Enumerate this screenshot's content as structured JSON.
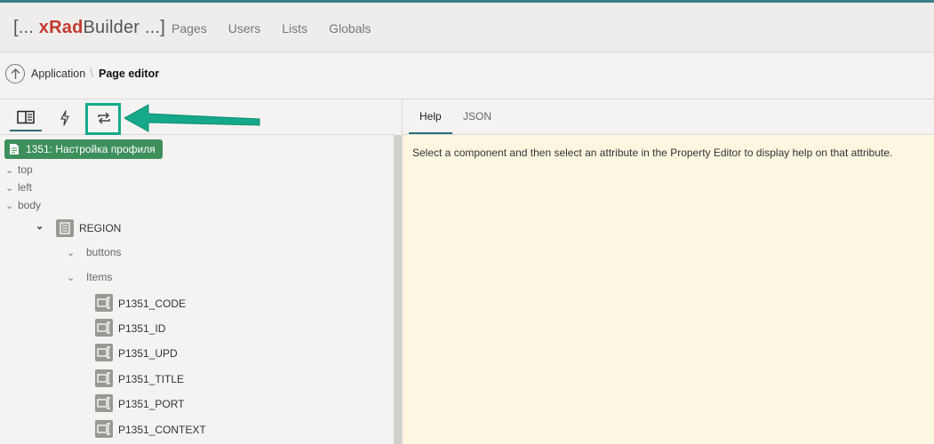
{
  "header": {
    "logo": {
      "bracket_open": "[...",
      "x": "x",
      "rad": "Rad",
      "builder": "Builder",
      "bracket_close": "...]"
    },
    "nav": [
      "Pages",
      "Users",
      "Lists",
      "Globals"
    ]
  },
  "breadcrumb": {
    "app": "Application",
    "separator": "\\",
    "page": "Page editor"
  },
  "left_tabs": [
    {
      "icon": "panel-layout-icon",
      "active": true
    },
    {
      "icon": "lightning-icon",
      "active": false
    },
    {
      "icon": "refresh-icon",
      "active": false
    }
  ],
  "tree": {
    "page_badge": "1351: Настройка профиля",
    "sections": [
      "top",
      "left",
      "body"
    ],
    "region": "REGION",
    "region_children": [
      "buttons",
      "Items"
    ],
    "items": [
      "P1351_CODE",
      "P1351_ID",
      "P1351_UPD",
      "P1351_TITLE",
      "P1351_PORT",
      "P1351_CONTEXT"
    ]
  },
  "right_tabs": [
    "Help",
    "JSON"
  ],
  "help_text": "Select a component and then select an attribute in the Property Editor to display help on that attribute.",
  "colors": {
    "accent": "#2a6d77",
    "annotation": "#15a98a",
    "badge": "#3d8f5c",
    "help_bg": "#fdf7e2"
  }
}
